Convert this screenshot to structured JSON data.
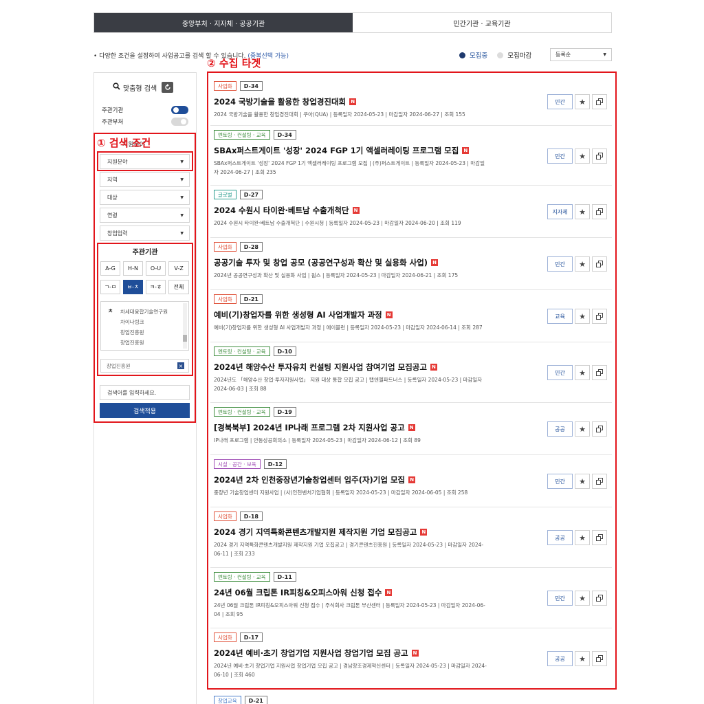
{
  "tabs": [
    {
      "label": "중앙부처 · 지자체 · 공공기관",
      "active": true
    },
    {
      "label": "민간기관 · 교육기관",
      "active": false
    }
  ],
  "info": {
    "text": "다양한 조건을 설정하여 사업공고를 검색 할 수 있습니다.",
    "highlight": "(중복선택 가능)"
  },
  "status": {
    "open_label": "모집중",
    "closed_label": "모집마감",
    "open_color": "#1f3a6e",
    "closed_color": "#dcdcdc"
  },
  "sort": {
    "selected": "등록순"
  },
  "annotations": {
    "search": "① 검색 조건",
    "target": "② 수집 타겟"
  },
  "sidebar": {
    "title": "맞춤형 검색",
    "toggles": [
      {
        "label": "주관기관",
        "on": true,
        "color": "#1f4e99"
      },
      {
        "label": "주관부처",
        "on": false,
        "color": "#d9d9d9"
      }
    ],
    "hidden_label": "지원분야",
    "filters": [
      "지원분야",
      "지역",
      "대상",
      "연령",
      "창업업력"
    ],
    "agency": {
      "title": "주관기관",
      "ranges": [
        "A-G",
        "H-N",
        "O-U",
        "V-Z",
        "ㄱ-ㅁ",
        "ㅂ-ㅊ",
        "ㅋ-ㅎ",
        "전체"
      ],
      "selected": "ㅂ-ㅊ",
      "index_char": "ㅊ",
      "list": [
        "차세대융합기술연구원",
        "차이나링크",
        "창업진흥원",
        "창업진흥원"
      ],
      "chosen": "창업진흥원"
    },
    "search_placeholder": "검색어를 입력하세요.",
    "apply": "검색적용"
  },
  "results": [
    {
      "category": "사업화",
      "dday": "D-34",
      "title": "2024 국방기술을 활용한 창업경진대회",
      "meta": "2024 국방기술을 활용한 창업경진대회 | 쿠아(QUA) | 등록일자 2024-05-23 | 마감일자 2024-06-27 | 조회 155",
      "type": "민간"
    },
    {
      "category": "멘토링 · 컨설팅 · 교육",
      "dday": "D-34",
      "title": "SBAx퍼스트게이트 '성장' 2024 FGP 1기 액셀러레이팅 프로그램 모집",
      "meta": "SBAx퍼스트게이트 '성장' 2024 FGP 1기 액셀러레이팅 프로그램 모집 | (주)퍼스트게이트 | 등록일자 2024-05-23 | 마감일자 2024-06-27 | 조회 235",
      "type": "민간"
    },
    {
      "category": "글로벌",
      "dday": "D-27",
      "title": "2024 수원시 타이완·베트남 수출개척단",
      "meta": "2024 수원시 타이완·베트남 수출개척단 | 수원시청 | 등록일자 2024-05-23 | 마감일자 2024-06-20 | 조회 119",
      "type": "지자체"
    },
    {
      "category": "사업화",
      "dday": "D-28",
      "title": "공공기술 투자 및 창업 공모 (공공연구성과 확산 및 실용화 사업)",
      "meta": "2024년 공공연구성과 확산 및 실용화 사업 | 윕스 | 등록일자 2024-05-23 | 마감일자 2024-06-21 | 조회 175",
      "type": "민간"
    },
    {
      "category": "사업화",
      "dday": "D-21",
      "title": "예비(기)창업자를 위한 생성형 AI 사업개발자 과정",
      "meta": "예비(기)창업자를 위한 생성형 AI 사업개발자 과정 | 에이블런 | 등록일자 2024-05-23 | 마감일자 2024-06-14 | 조회 287",
      "type": "교육"
    },
    {
      "category": "멘토링 · 컨설팅 · 교육",
      "dday": "D-10",
      "title": "2024년 해양수산 투자유치 컨설팅 지원사업 참여기업 모집공고",
      "meta": "2024년도 「해양수산 창업·투자지원사업」 지원 대상 통합 모집 공고 | 탭엔젤파트너스 | 등록일자 2024-05-23 | 마감일자 2024-06-03 | 조회 88",
      "type": "민간"
    },
    {
      "category": "멘토링 · 컨설팅 · 교육",
      "dday": "D-19",
      "title": "[경북북부] 2024년 IP나래 프로그램 2차 지원사업 공고",
      "meta": "IP나래 프로그램 | 안동상공회의소 | 등록일자 2024-05-23 | 마감일자 2024-06-12 | 조회 89",
      "type": "공공"
    },
    {
      "category": "시설 · 공간 · 보육",
      "dday": "D-12",
      "title": "2024년 2차 인천중장년기술창업센터 입주(자)기업 모집",
      "meta": "중장년 기술창업센터 지원사업 | (사)인천벤처기업협회 | 등록일자 2024-05-23 | 마감일자 2024-06-05 | 조회 258",
      "type": "민간"
    },
    {
      "category": "사업화",
      "dday": "D-18",
      "title": "2024 경기 지역특화콘텐츠개발지원 제작지원 기업 모집공고",
      "meta": "2024 경기 지역특화콘텐츠개발지원 제작지원 기업 모집공고 | 경기콘텐츠진흥원 | 등록일자 2024-05-23 | 마감일자 2024-06-11 | 조회 233",
      "type": "공공"
    },
    {
      "category": "멘토링 · 컨설팅 · 교육",
      "dday": "D-11",
      "title": "24년 06월 크립톤 IR피칭&오피스아워 신청 접수",
      "meta": "24년 06월 크립톤 IR피칭&오피스아워 신청 접수 | 주식회사 크립톤 부산센터 | 등록일자 2024-05-23 | 마감일자 2024-06-04 | 조회 95",
      "type": "민간"
    },
    {
      "category": "사업화",
      "dday": "D-17",
      "title": "2024년 예비·초기 창업기업 지원사업 창업기업 모집 공고",
      "meta": "2024년 예비·초기 창업기업 지원사업 창업기업 모집 공고 | 경남창조경제혁신센터 | 등록일자 2024-05-23 | 마감일자 2024-06-10 | 조회 460",
      "type": "공공"
    }
  ],
  "partial": {
    "category": "창업교육",
    "dday": "D-21"
  },
  "category_colors": {
    "사업화": "#e0523a",
    "멘토링 · 컨설팅 · 교육": "#3c8c3c",
    "글로벌": "#2a9d8f",
    "시설 · 공간 · 보육": "#a04fb6",
    "창업교육": "#4a7dc9"
  }
}
